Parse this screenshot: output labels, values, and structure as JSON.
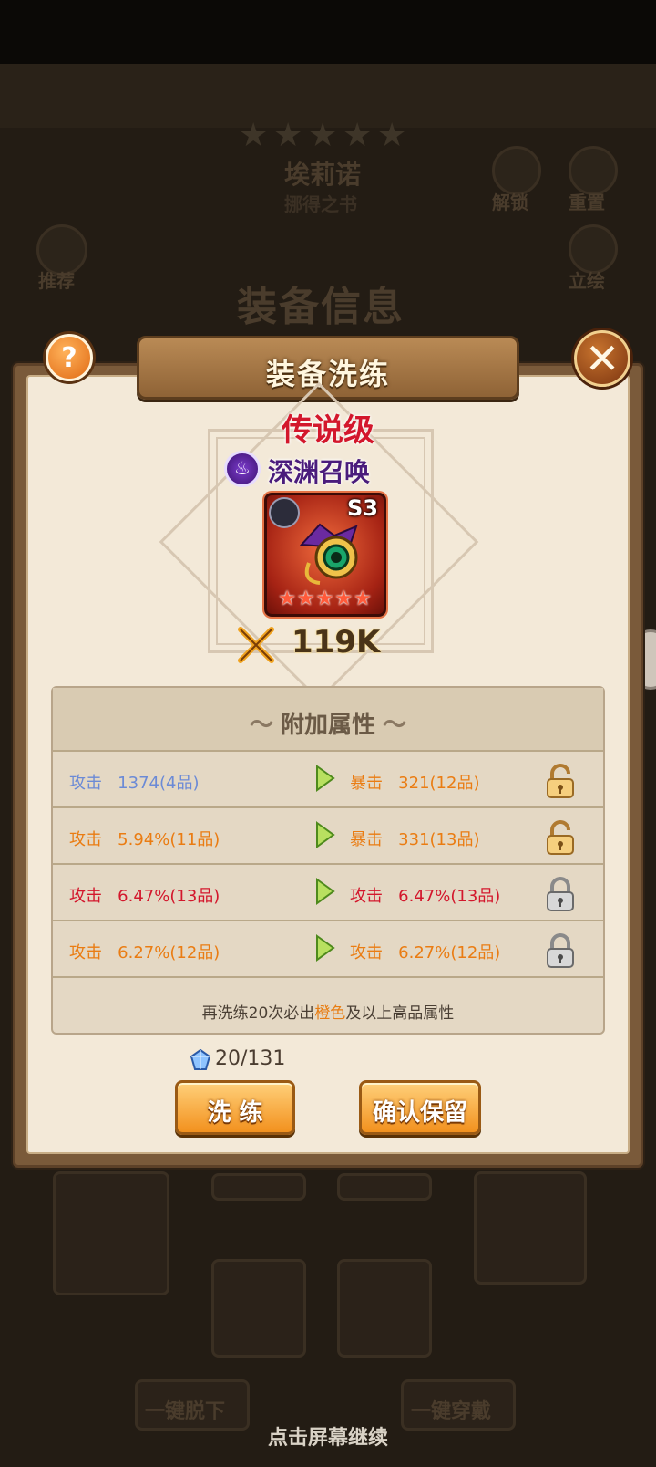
{
  "background": {
    "header_title": "装备信息",
    "hero_name": "埃莉诺",
    "hero_subtitle": "挪得之书",
    "unlock_label": "解锁",
    "reset_label": "重置",
    "recommend_label": "推荐",
    "portrait_label": "立绘",
    "unequip_all_label": "一键脱下",
    "equip_all_label": "一键穿戴",
    "tap_continue": "点击屏幕继续"
  },
  "dialog": {
    "title": "装备洗练",
    "help_label": "?",
    "close_label": "✕",
    "rarity": "传说级",
    "set_name": "深渊召唤",
    "equipment": {
      "level_label": "S3",
      "stars": 5,
      "stars_text": "★★★★★"
    },
    "power": "119K"
  },
  "attributes": {
    "header": "附加属性",
    "rows": [
      {
        "old_name": "攻击",
        "old_value": "1374(4品)",
        "old_color": "#6b8ad6",
        "new_name": "暴击",
        "new_value": "321(12品)",
        "new_color": "#ea7c12",
        "locked": false
      },
      {
        "old_name": "攻击",
        "old_value": "5.94%(11品)",
        "old_color": "#ea7c12",
        "new_name": "暴击",
        "new_value": "331(13品)",
        "new_color": "#ea7c12",
        "locked": false
      },
      {
        "old_name": "攻击",
        "old_value": "6.47%(13品)",
        "old_color": "#d3172c",
        "new_name": "攻击",
        "new_value": "6.47%(13品)",
        "new_color": "#d3172c",
        "locked": true
      },
      {
        "old_name": "攻击",
        "old_value": "6.27%(12品)",
        "old_color": "#ea7c12",
        "new_name": "攻击",
        "new_value": "6.27%(12品)",
        "new_color": "#ea7c12",
        "locked": true
      }
    ],
    "hint_prefix": "再洗练20次必出",
    "hint_highlight": "橙色",
    "hint_suffix": "及以上高品属性"
  },
  "cost": {
    "text": "20/131"
  },
  "buttons": {
    "refine": "洗 练",
    "confirm": "确认保留"
  },
  "colors": {
    "accent_orange": "#f2911e",
    "quality_red": "#d3172c",
    "quality_orange": "#ea7c12",
    "quality_blue": "#6b8ad6"
  }
}
